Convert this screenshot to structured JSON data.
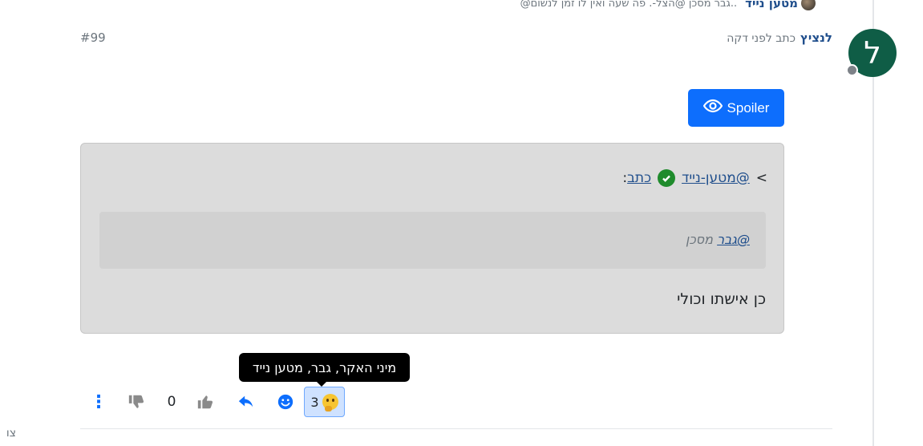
{
  "previous_reply": {
    "author": "מטען נייד",
    "text": "@גבר מסכן @הצל-. פה שעה ואין לו זמן לנשום.."
  },
  "post": {
    "avatar_letter": "ל",
    "author": "לנציץ",
    "timestamp": "כתב לפני דקה",
    "index": "#99",
    "spoiler_label": "Spoiler",
    "quote": {
      "marker": ">",
      "author_link": "@מטען-נייד",
      "wrote_link": "כתב",
      "colon": ":",
      "inner_mention": "@גבר",
      "inner_text": " מסכן",
      "body": "כן אישתו וכולי"
    }
  },
  "actions": {
    "reaction_count": "3",
    "reaction_tooltip": "מיני האקר, גבר, מטען נייד",
    "vote_count": "0",
    "kebab": "⋮"
  },
  "edge_text": "צו",
  "colors": {
    "primary": "#0d6efd",
    "author": "#1f4e8c",
    "avatar_bg": "#0f5d46",
    "quote_bg": "#dcdcdc",
    "check": "#1f8b2c"
  },
  "icons": [
    "eye-icon",
    "check-circle-icon",
    "thumbs-up-icon",
    "thumbs-down-icon",
    "reply-icon",
    "smile-icon",
    "thinking-face-icon",
    "kebab-menu-icon"
  ]
}
